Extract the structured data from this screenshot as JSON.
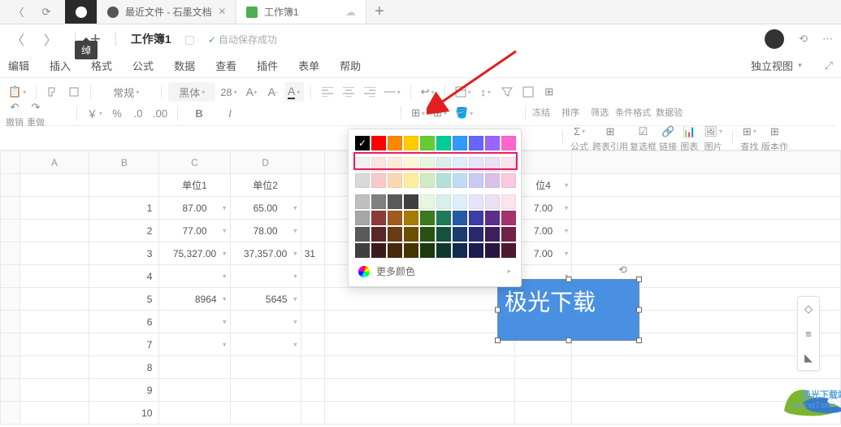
{
  "tabs": {
    "t1": "最近文件 - 石墨文档",
    "t2": "工作簿1"
  },
  "titlebar": {
    "title": "工作簿1",
    "status": "自动保存成功"
  },
  "menu": [
    "编辑",
    "插入",
    "格式",
    "公式",
    "数据",
    "查看",
    "插件",
    "表单",
    "帮助"
  ],
  "menu_right": "独立视图",
  "tb": {
    "undo": "撤销",
    "redo": "重做",
    "general": "常规",
    "font": "黑体",
    "size": "28",
    "freeze": "冻结",
    "sort": "排序",
    "filter": "筛选",
    "condfmt": "条件格式",
    "validate": "数据验",
    "formula": "公式",
    "crossref": "跨表引用",
    "checkbox": "复选框",
    "link": "链接",
    "image": "图表",
    "img2": "图片",
    "find": "查找",
    "version": "版本作"
  },
  "sheet": {
    "cols": [
      "A",
      "B",
      "C",
      "D"
    ],
    "row1": {
      "c": "单位1",
      "d": "单位2",
      "h": "位4"
    },
    "data": [
      {
        "b": "1",
        "c": "87.00",
        "d": "65.00",
        "h": "7.00"
      },
      {
        "b": "2",
        "c": "77.00",
        "d": "78.00",
        "h": "7.00"
      },
      {
        "b": "3",
        "c": "75,327.00",
        "d": "37,357.00",
        "e": "31",
        "h": "7.00"
      },
      {
        "b": "4"
      },
      {
        "b": "5",
        "c": "8964",
        "d": "5645"
      },
      {
        "b": "6"
      },
      {
        "b": "7"
      },
      {
        "b": "8"
      },
      {
        "b": "9"
      },
      {
        "b": "10"
      }
    ]
  },
  "colorpicker": {
    "more": "更多颜色",
    "tooltip": "绰",
    "rows": [
      [
        "#000000",
        "#ff0000",
        "#ff8800",
        "#ffcc00",
        "#66cc33",
        "#00cc99",
        "#3399ff",
        "#6666ff",
        "#9966ff",
        "#ff66cc"
      ],
      [
        "#f2f2f2",
        "#fce4e4",
        "#fdebd8",
        "#fff6d9",
        "#e8f5e0",
        "#d9f0ea",
        "#e0edfb",
        "#e4e4fa",
        "#ece0f5",
        "#fce4ef"
      ],
      [
        "#d9d9d9",
        "#f8c9c9",
        "#fbd7b1",
        "#ffed9e",
        "#d1ebc2",
        "#b3e1d5",
        "#c1dbf7",
        "#c9c9f5",
        "#d9c1eb",
        "#f9c9df"
      ],
      [
        "#bfbfbf",
        "#808080",
        "#595959",
        "#404040",
        "#e8f5e0",
        "#d9f0ea",
        "#e0edfb",
        "#e4e4fa",
        "#ece0f5",
        "#fce4ef"
      ],
      [
        "#a6a6a6",
        "#8c3a3a",
        "#a05a1e",
        "#a67c00",
        "#3d7a1f",
        "#1f7a5c",
        "#2659a6",
        "#3d3da6",
        "#5c2e8c",
        "#a6336b"
      ],
      [
        "#595959",
        "#5c2626",
        "#6b3c14",
        "#6b5000",
        "#285214",
        "#14523d",
        "#1a3d70",
        "#292970",
        "#3d1f5c",
        "#702347"
      ],
      [
        "#404040",
        "#3d1a1a",
        "#47280d",
        "#473500",
        "#1b3a0e",
        "#0e3a2b",
        "#122b4f",
        "#1c1c4f",
        "#2b1540",
        "#4f1832"
      ]
    ]
  },
  "textbox": "极光下载",
  "watermark": {
    "text": "极光下载站",
    "url": "www.xz7.com"
  }
}
